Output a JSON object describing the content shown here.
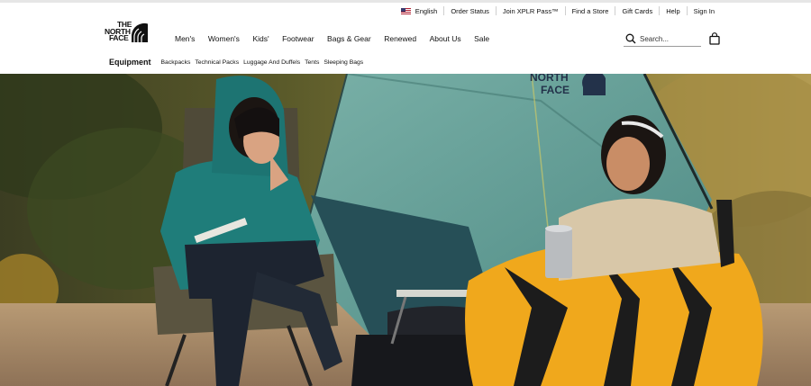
{
  "utility_nav": {
    "language": "English",
    "order_status": "Order Status",
    "join": "Join XPLR Pass™",
    "find_store": "Find a Store",
    "gift_cards": "Gift Cards",
    "help": "Help",
    "sign_in": "Sign In"
  },
  "logo": {
    "line1": "THE",
    "line2": "NORTH",
    "line3": "FACE"
  },
  "main_nav": {
    "mens": "Men's",
    "womens": "Women's",
    "kids": "Kids'",
    "footwear": "Footwear",
    "bags_gear": "Bags & Gear",
    "renewed": "Renewed",
    "about": "About Us",
    "sale": "Sale"
  },
  "search": {
    "placeholder": "Search..."
  },
  "sub_nav": {
    "title": "Equipment",
    "items": [
      "Backpacks",
      "Technical Packs",
      "Luggage And Duffels",
      "Tents",
      "Sleeping Bags"
    ]
  },
  "hero": {
    "tent_logo_line1": "NORTH",
    "tent_logo_line2": "FACE"
  },
  "icons": {
    "search": "search-icon",
    "bag": "shopping-bag-icon",
    "flag": "us-flag-icon",
    "logo": "the-north-face-logo"
  },
  "colors": {
    "text": "#111111",
    "tent": "#5f9a94",
    "hoodie": "#1f7d7a",
    "sleeping_bag": "#f0a81c"
  }
}
